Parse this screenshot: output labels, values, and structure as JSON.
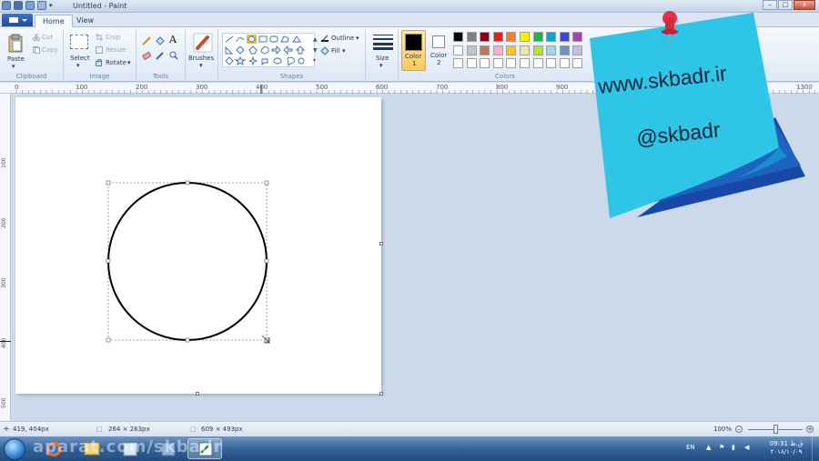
{
  "window": {
    "title": "Untitled - Paint",
    "minimize": "–",
    "maximize": "□",
    "close": "x"
  },
  "tabs": [
    {
      "label": "Home",
      "active": true
    },
    {
      "label": "View",
      "active": false
    }
  ],
  "clipboard": {
    "paste": "Paste",
    "cut": "Cut",
    "copy": "Copy",
    "group": "Clipboard"
  },
  "image": {
    "select": "Select",
    "crop": "Crop",
    "resize": "Resize",
    "rotate": "Rotate",
    "group": "Image"
  },
  "tools": {
    "group": "Tools",
    "text_tool": "A"
  },
  "brushes": {
    "label": "Brushes"
  },
  "shapes": {
    "outline": "Outline",
    "fill": "Fill",
    "group": "Shapes"
  },
  "size": {
    "label": "Size"
  },
  "color1": {
    "label1": "Color",
    "label2": "1",
    "value": "#000000"
  },
  "color2": {
    "label1": "Color",
    "label2": "2",
    "value": "#ffffff"
  },
  "colors": {
    "group": "Colors",
    "row1": [
      "#000000",
      "#7f7f7f",
      "#880015",
      "#ed1c24",
      "#ff7f27",
      "#fff200",
      "#22b14c",
      "#00a2e8",
      "#3f48cc",
      "#a349a4"
    ],
    "row2": [
      "#ffffff",
      "#c3c3c3",
      "#b97a57",
      "#ffaec9",
      "#ffc90e",
      "#efe4b0",
      "#b5e61d",
      "#99d9ea",
      "#7092be",
      "#c8bfe7"
    ]
  },
  "ruler": {
    "h_ticks": [
      "0",
      "100",
      "200",
      "300",
      "400",
      "500",
      "600",
      "700",
      "800",
      "900",
      "1300"
    ],
    "v_ticks": [
      "100",
      "200",
      "300",
      "400",
      "500"
    ]
  },
  "status": {
    "cursor_pos": "419, 404px",
    "selection_size": "264 × 263px",
    "image_size": "609 × 493px",
    "zoom": "100%"
  },
  "taskbar": {
    "watermark": "aparat.com/skbadr",
    "lang": "EN",
    "time": "09:31 ق.ظ",
    "date": "۲۰۱۸/۱۰/۰۹"
  },
  "note": {
    "line1": "www.skbadr.ir",
    "line2": "@skbadr",
    "color": "#2ec5e6"
  }
}
